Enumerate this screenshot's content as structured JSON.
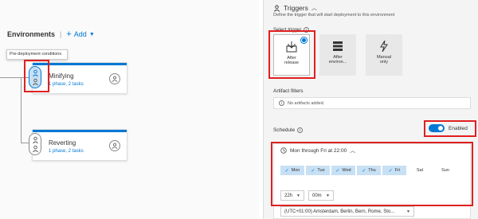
{
  "pipeline": {
    "environments_title": "Environments",
    "add_label": "Add",
    "tooltip": "Pre-deployment conditions",
    "stages": [
      {
        "name": "Minifying",
        "tasks": "1 phase, 2 tasks"
      },
      {
        "name": "Reverting",
        "tasks": "1 phase, 2 tasks"
      }
    ]
  },
  "triggers": {
    "title": "Triggers",
    "description": "Define the trigger that will start deployment to this environment",
    "select_label": "Select trigger",
    "options": [
      {
        "label_line1": "After",
        "label_line2": "release",
        "selected": true
      },
      {
        "label_line1": "After",
        "label_line2": "environ...",
        "selected": false
      },
      {
        "label_line1": "Manual",
        "label_line2": "only",
        "selected": false
      }
    ]
  },
  "artifact_filters": {
    "label": "Artifact filters",
    "empty_text": "No artifacts added."
  },
  "schedule": {
    "label": "Schedule",
    "toggle_label": "Enabled",
    "enabled": true,
    "summary": "Mon through Fri at 22:00",
    "days": [
      {
        "name": "Mon",
        "on": true
      },
      {
        "name": "Tue",
        "on": true
      },
      {
        "name": "Wed",
        "on": true
      },
      {
        "name": "Thu",
        "on": true
      },
      {
        "name": "Fri",
        "on": true
      },
      {
        "name": "Sat",
        "on": false
      },
      {
        "name": "Sun",
        "on": false
      }
    ],
    "hour": "22h",
    "minute": "00m",
    "timezone": "(UTC+01:00) Amsterdam, Berlin, Bern, Rome, Sto..."
  },
  "colors": {
    "accent": "#0078d4",
    "highlight": "#e02020",
    "day_on": "#c7e0f4"
  }
}
